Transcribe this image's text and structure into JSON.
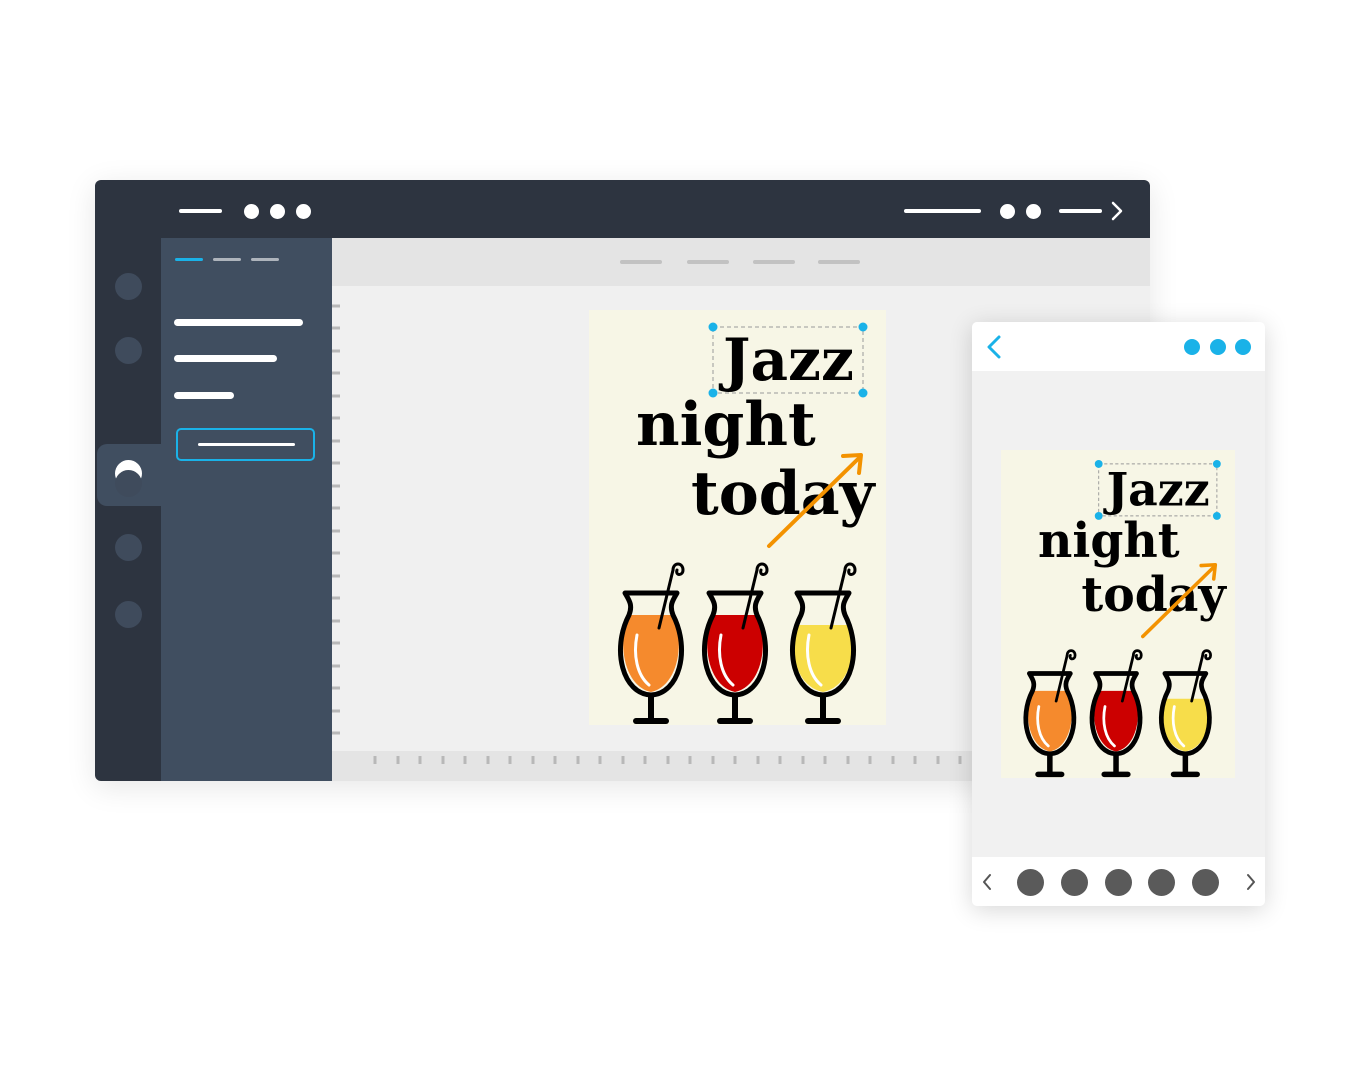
{
  "poster": {
    "title_line1": "Jazz",
    "title_line2": "night",
    "title_line3": "today"
  },
  "icons": {
    "mobile_back": "chevron-left-icon",
    "mobile_menu": "more-dots-icon",
    "mobile_prev": "chevron-left-icon",
    "mobile_next": "chevron-right-icon",
    "window_forward": "chevron-right-icon"
  },
  "colors": {
    "titlebar": "#2d3440",
    "panel": "#404e60",
    "accent": "#1ab2e8",
    "poster_bg": "#f7f6e6",
    "arrow": "#f39200",
    "drink_orange": "#f58a2d",
    "drink_red": "#cc0000",
    "drink_yellow": "#f7dd4a"
  }
}
